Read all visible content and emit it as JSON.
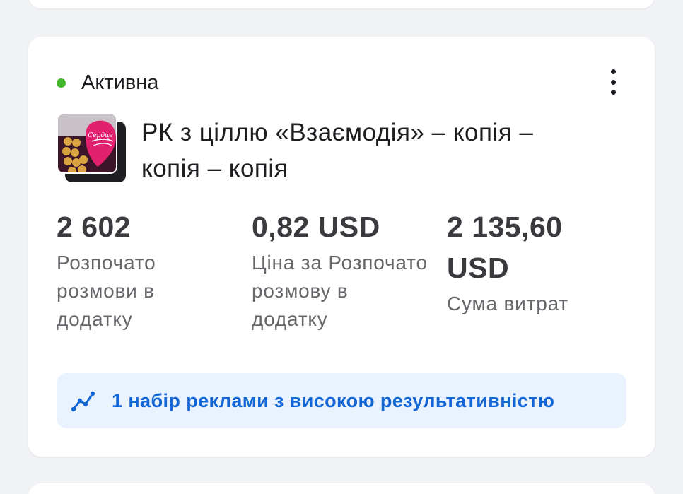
{
  "campaign": {
    "status": "Активна",
    "status_color": "#42b72a",
    "title": "РК з ціллю «Взаємодія» – копія – копія – копія",
    "thumbnail_label": "Сердце"
  },
  "metrics": [
    {
      "value": "2 602",
      "label": "Розпочато розмови в додатку"
    },
    {
      "value": "0,82 USD",
      "label": "Ціна за Розпочато розмову в додатку"
    },
    {
      "value": "2 135,60 USD",
      "label": "Сума витрат"
    }
  ],
  "insight": {
    "text": "1 набір реклами з високою результативністю",
    "icon": "trend-line-icon",
    "accent": "#1366d6",
    "background": "#e9f2fd"
  },
  "menu_icon": "more-vertical-icon"
}
